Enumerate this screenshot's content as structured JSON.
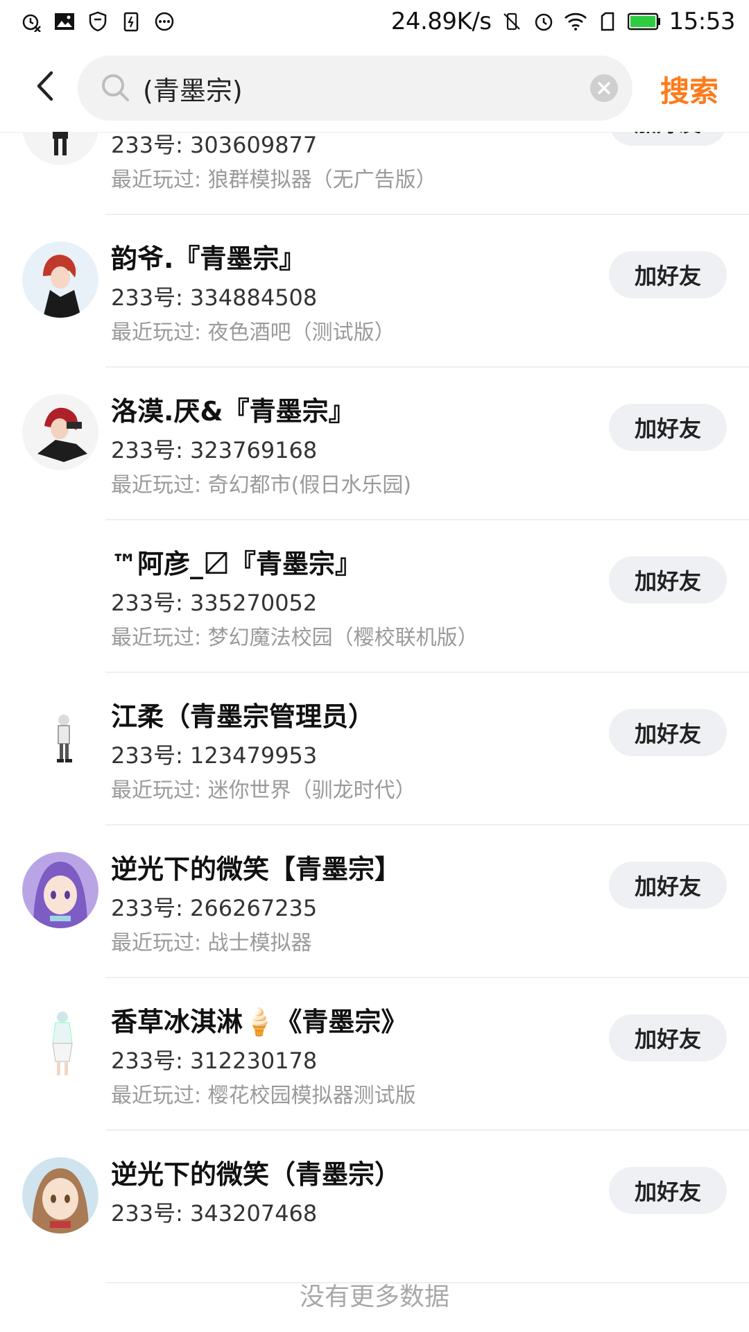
{
  "status_bar": {
    "speed": "24.89K/s",
    "time": "15:53"
  },
  "search": {
    "query": "(青墨宗)",
    "action_label": "搜索"
  },
  "add_button_label": "加好友",
  "uid_prefix": "233号: ",
  "played_prefix": "最近玩过: ",
  "results": [
    {
      "name": "",
      "uid": "233号: 303609877",
      "played": "最近玩过: 狼群模拟器（无广告版）"
    },
    {
      "name": "韵爷.『青墨宗』",
      "uid": "233号: 334884508",
      "played": "最近玩过: 夜色酒吧（测试版）"
    },
    {
      "name": "洛漠.厌&『青墨宗』",
      "uid": "233号: 323769168",
      "played": "最近玩过: 奇幻都市(假日水乐园)"
    },
    {
      "name": "™阿彦_〼『青墨宗』",
      "uid": "233号: 335270052",
      "played": "最近玩过: 梦幻魔法校园（樱校联机版）"
    },
    {
      "name": "江柔（青墨宗管理员）",
      "uid": "233号: 123479953",
      "played": "最近玩过: 迷你世界（驯龙时代）"
    },
    {
      "name": "逆光下的微笑【青墨宗】",
      "uid": "233号: 266267235",
      "played": "最近玩过: 战士模拟器"
    },
    {
      "name": "香草冰淇淋🍦《青墨宗》",
      "uid": "233号: 312230178",
      "played": "最近玩过: 樱花校园模拟器测试版"
    },
    {
      "name": "逆光下的微笑（青墨宗）",
      "uid": "233号: 343207468",
      "played": ""
    }
  ],
  "footer_text": "没有更多数据",
  "colors": {
    "accent": "#ff7a1a",
    "button_bg": "#eef0f3"
  }
}
